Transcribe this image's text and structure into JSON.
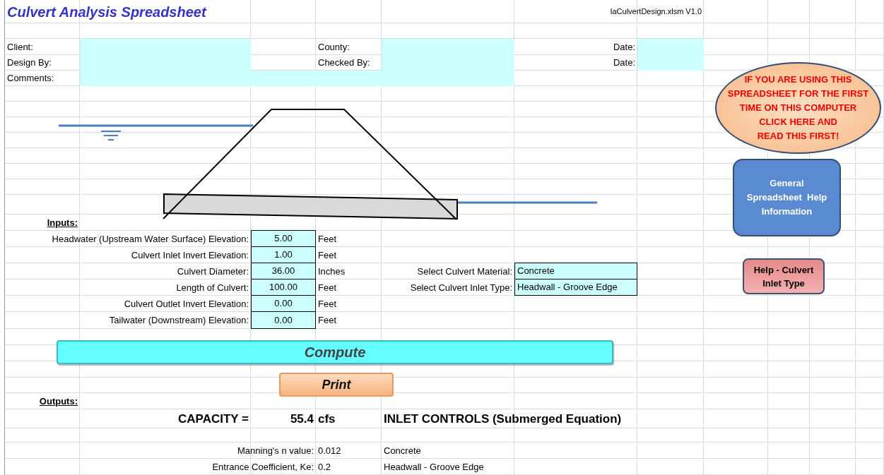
{
  "title": "Culvert Analysis Spreadsheet",
  "file_version": "IaCulvertDesign.xlsm V1.0",
  "header_rows": [
    [
      {
        "label": "Client:"
      },
      {
        "label": "County:"
      },
      {
        "label": "Date:"
      }
    ],
    [
      {
        "label": "Design By:"
      },
      {
        "label": "Checked By:"
      },
      {
        "label": "Date:"
      }
    ],
    [
      {
        "label": "Comments:"
      }
    ]
  ],
  "inputs_heading": "Inputs:",
  "inputs": [
    {
      "label": "Headwater (Upstream Water Surface) Elevation:",
      "value": "5.00",
      "unit": "Feet"
    },
    {
      "label": "Culvert Inlet Invert Elevation:",
      "value": "1.00",
      "unit": "Feet"
    },
    {
      "label": "Culvert Diameter:",
      "value": "36.00",
      "unit": "Inches"
    },
    {
      "label": "Length of Culvert:",
      "value": "100.00",
      "unit": "Feet"
    },
    {
      "label": "Culvert Outlet Invert Elevation:",
      "value": "0.00",
      "unit": "Feet"
    },
    {
      "label": "Tailwater (Downstream) Elevation:",
      "value": "0.00",
      "unit": "Feet"
    }
  ],
  "selections": [
    {
      "label": "Select Culvert Material:",
      "value": "Concrete"
    },
    {
      "label": "Select Culvert Inlet Type:",
      "value": "Headwall - Groove Edge"
    }
  ],
  "compute_button": "Compute",
  "print_button": "Print",
  "outputs_heading": "Outputs:",
  "capacity": {
    "label": "CAPACITY =",
    "value": "55.4",
    "unit": "cfs",
    "control": "INLET CONTROLS (Submerged Equation)"
  },
  "output_rows": [
    {
      "label": "Manning's n value:",
      "value": "0.012",
      "note": "Concrete"
    },
    {
      "label": "Entrance Coefficient, Ke:",
      "value": "0.2",
      "note": "Headwall - Groove Edge"
    }
  ],
  "help_buttons": [
    {
      "kind": "oval",
      "lines": [
        "IF YOU ARE USING THIS",
        "SPREADSHEET FOR THE FIRST",
        "TIME ON THIS COMPUTER",
        "CLICK HERE AND",
        "READ THIS FIRST!"
      ]
    },
    {
      "kind": "rounded",
      "lines": [
        "General",
        "Spreadsheet  Help",
        "Information"
      ]
    },
    {
      "kind": "small",
      "lines": [
        "Help - Culvert",
        "Inlet Type"
      ]
    }
  ]
}
